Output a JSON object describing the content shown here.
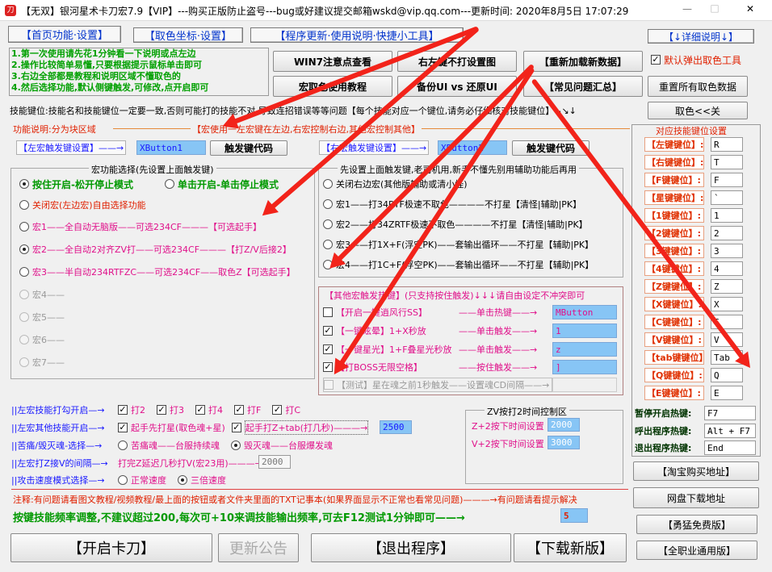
{
  "window": {
    "title": "【无双】银河星术卡刀宏7.9【VIP】---购买正版防止盗号---bug或好建议提交邮箱wskd@vip.qq.com---更新时间: 2020年8月5日 17:07:29",
    "minimize": "—",
    "maximize": "□",
    "close": "✕"
  },
  "tabs": {
    "home": "【首页功能·设置】",
    "color": "【取色坐标·设置】",
    "update": "【程序更新·使用说明·快捷小工具】",
    "detail": "【↓详细说明↓】"
  },
  "notes": [
    "1.第一次使用请先花1分钟看一下说明或点左边",
    "2.操作比较简单易懂,只要根据提示鼠标单击即可",
    "3.右边全部都是教程和说明区域不懂取色的",
    "4.然后选择功能,默认侧键触发,可修改,点开启即可"
  ],
  "topbuttons": {
    "win7": "WIN7注意点查看",
    "rclick": "右左键不打设置图",
    "reload": "【重新加载新数据】",
    "default_popup": "默认弹出取色工具",
    "macro_tutorial": "宏取色使用教程",
    "backup": "备份UI vs 还原UI",
    "faq": "【常见问题汇总】",
    "reset_colors": "重置所有取色数据"
  },
  "skillkey_note": "技能键位:技能名和技能键位一定要一致,否则可能打的技能不对,导致连招错误等等问题【每个技能对应一个键位,请务必仔细核对技能键位】↘↘↓",
  "pick_close": "取色<<关",
  "func_desc": {
    "label": "功能说明:分为块区域",
    "text": "【宏使用一左宏键在左边,右宏控制右边,其他宏控制其他】"
  },
  "left_trigger": {
    "label": "【左宏触发键设置】——→",
    "value": "XButton1",
    "code_btn": "触发键代码"
  },
  "right_trigger": {
    "label": "【右宏触发键设置】——→",
    "value": "XButton2",
    "code_btn": "触发键代码"
  },
  "macro_select": {
    "title": "宏功能选择(先设置上面触发键)",
    "mode_hold": "按住开启-松开停止模式",
    "mode_click": "单击开启-单击停止模式",
    "items": [
      "关闭宏(左边宏)自由选择功能",
      "宏1——全自动无脑版——可选234CF———【可选起手】",
      "宏2——全自动2对齐ZV打——可选234CF———【打Z/V后接2】",
      "宏3——半自动234RTFZC——可选234CF——取色Z【可选起手】",
      "宏4——",
      "宏5——",
      "宏6——",
      "宏7——"
    ]
  },
  "right_macro": {
    "title": "先设置上面触发键,老司机用,新手不懂先别用辅助功能后再用",
    "items": [
      "关闭右边宏(其他版辅助或清小怪)",
      "宏1——打34RTF极速不取色————不打星【清怪|辅助|PK】",
      "宏2——打34ZRTF极速不取色————不打星【清怪|辅助|PK】",
      "宏3——打1X+F(浮空PK)——套输出循环——不打星【辅助|PK】",
      "宏4——打1C+F(浮空PK)——套输出循环——不打星【辅助|PK】"
    ]
  },
  "other_macro": {
    "title": "【其他宏触发热键】(只支持按住触发)↓↓↓请自由设定不冲突即可",
    "items": [
      {
        "label": "【开启一键逍风行SS】",
        "mode": "——单击热键——→",
        "value": "MButton"
      },
      {
        "label": "【一键眩晕】1+X秒放",
        "mode": "——单击触发——→",
        "value": "1"
      },
      {
        "label": "【一键星光】1+F叠星光秒放",
        "mode": "——单击触发——→",
        "value": "z"
      },
      {
        "label": "【打BOSS无限空格】",
        "mode": "——按住触发——→",
        "value": "]"
      },
      {
        "label": "【测试】星在魂之前1秒触发——设置魂CD间隔——→",
        "mode": "",
        "value": ""
      }
    ]
  },
  "bottom": {
    "row1_label": "||左宏技能打勾开启—→",
    "skills": [
      "打2",
      "打3",
      "打4",
      "打F",
      "打C"
    ],
    "row2_label": "||左宏其他技能开启—→",
    "row2_a": "起手先打星(取色魂+星)",
    "row2_b": "起手打Z+tab(打几秒)———→",
    "row2_val": "2500",
    "row3_label": "||苦痛/毁灭魂-选择—→",
    "row3_a": "苦痛魂——台服持续魂",
    "row3_b": "毁灭魂——台服爆发魂",
    "row4_label": "||左宏打Z接V的间隔—→",
    "row4_text": "打完Z延迟几秒打V(宏23用)———→",
    "row4_val": "2000",
    "row5_label": "||攻击速度模式选择—→",
    "row5_a": "正常速度",
    "row5_b": "三倍速度"
  },
  "zv": {
    "title": "ZV按打2时间控制区",
    "z_label": "Z+2按下时间设置",
    "z_val": "2000",
    "v_label": "V+2按下时间设置",
    "v_val": "3000"
  },
  "notice": "注释:有问题请看图文教程/视频教程/最上面的按钮或者文件夹里面的TXT记事本(如果界面显示不正常也看常见问题)———→有问题请看提示解决",
  "freq": {
    "text": "按键技能频率调整,不建议超过200,每次可+10来调技能输出频率,可去F12测试1分钟即可——→",
    "value": "5"
  },
  "actions": {
    "start": "【开启卡刀】",
    "news": "更新公告",
    "exit": "【退出程序】",
    "download": "【下载新版】"
  },
  "keymap": {
    "title": "对应技能键位设置",
    "items": [
      {
        "label": "【左键键位】:",
        "value": "R"
      },
      {
        "label": "【右键键位】:",
        "value": "T"
      },
      {
        "label": "【F键键位】:",
        "value": "F"
      },
      {
        "label": "【星键键位】:",
        "value": "`"
      },
      {
        "label": "【1键键位】:",
        "value": "1"
      },
      {
        "label": "【2键键位】:",
        "value": "2"
      },
      {
        "label": "【3键键位】:",
        "value": "3"
      },
      {
        "label": "【4键键位】:",
        "value": "4"
      },
      {
        "label": "【Z键键位】:",
        "value": "Z"
      },
      {
        "label": "【X键键位】:",
        "value": "X"
      },
      {
        "label": "【C键键位】:",
        "value": "C"
      },
      {
        "label": "【V键键位】:",
        "value": "V"
      },
      {
        "label": "【tab键键位】:",
        "value": "Tab"
      },
      {
        "label": "【Q键键位】:",
        "value": "Q"
      },
      {
        "label": "【E键键位】:",
        "value": "E"
      }
    ],
    "hotkeys": [
      {
        "label": "暂停开启热键:",
        "value": "F7"
      },
      {
        "label": "呼出程序热键:",
        "value": "Alt + F7"
      },
      {
        "label": "退出程序热键:",
        "value": "End"
      }
    ]
  },
  "side_buttons": {
    "taobao": "【淘宝购买地址】",
    "netdisk": "网盘下载地址",
    "free": "【勇猛免费版】",
    "all": "【全职业通用版】"
  },
  "colors": {
    "accent_red": "#f2231a",
    "field_blue": "#87c5f5",
    "link_blue": "#1a1aff",
    "green": "#009900"
  }
}
